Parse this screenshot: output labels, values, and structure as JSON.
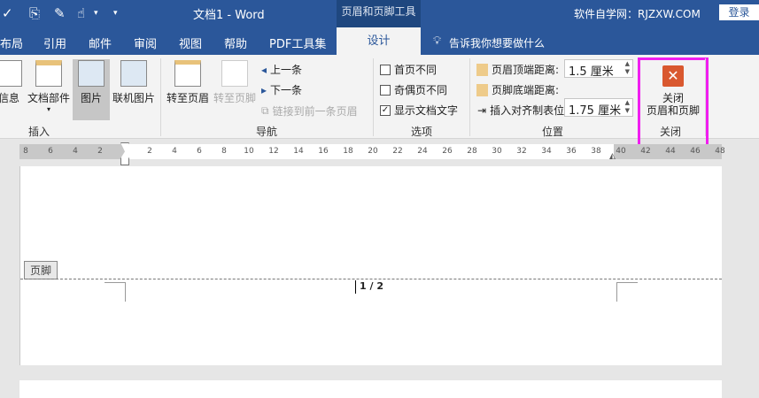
{
  "titlebar": {
    "title": "文档1  -  Word",
    "context_tool": "页眉和页脚工具",
    "site": "软件自学网：RJZXW.COM",
    "login": "登录"
  },
  "tabs": [
    "布局",
    "引用",
    "邮件",
    "审阅",
    "视图",
    "帮助",
    "PDF工具集"
  ],
  "active_tab": "设计",
  "tell_me": "告诉我你想要做什么",
  "insert_group": {
    "items": [
      "信息",
      "文档部件",
      "图片",
      "联机图片"
    ],
    "label": "插入"
  },
  "nav_group": {
    "goto_header": "转至页眉",
    "goto_footer": "转至页脚",
    "prev": "上一条",
    "next": "下一条",
    "link_prev": "链接到前一条页眉",
    "label": "导航"
  },
  "options_group": {
    "items": [
      {
        "label": "首页不同",
        "checked": false
      },
      {
        "label": "奇偶页不同",
        "checked": false
      },
      {
        "label": "显示文档文字",
        "checked": true
      }
    ],
    "label": "选项"
  },
  "position_group": {
    "header_top_label": "页眉顶端距离:",
    "header_top_value": "1.5 厘米",
    "footer_bottom_label": "页脚底端距离:",
    "footer_bottom_value": "1.75 厘米",
    "insert_tab": "插入对齐制表位",
    "label": "位置"
  },
  "close_group": {
    "button_line1": "关闭",
    "button_line2": "页眉和页脚",
    "label": "关闭"
  },
  "ruler": {
    "left": [
      "8",
      "6",
      "4",
      "2"
    ],
    "main": [
      "2",
      "4",
      "6",
      "8",
      "10",
      "12",
      "14",
      "16",
      "18",
      "20",
      "22",
      "24",
      "26",
      "28",
      "30",
      "32",
      "34",
      "36",
      "38"
    ],
    "right": [
      "40",
      "42",
      "44",
      "46",
      "48"
    ]
  },
  "document": {
    "footer_tag": "页脚",
    "page_number": "1 / 2"
  }
}
